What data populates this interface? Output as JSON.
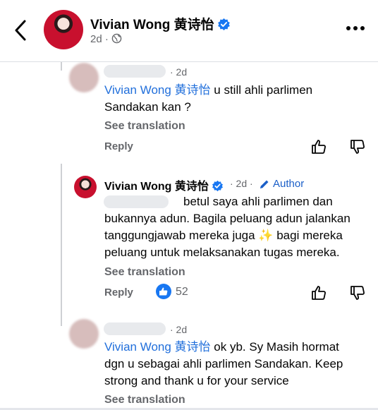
{
  "header": {
    "name": "Vivian Wong 黄诗怡",
    "time": "2d",
    "separator": "·"
  },
  "comments": [
    {
      "time": "· 2d",
      "mention": "Vivian Wong 黄诗怡",
      "text_line1": " u still ahli parlimen",
      "text_line2": "Sandakan kan ?",
      "see_translation": "See translation",
      "reply": "Reply"
    },
    {
      "author_name": "Vivian Wong 黄诗怡",
      "time": "· 2d ·",
      "author_badge": "Author",
      "text_line1": "betul saya ahli parlimen dan",
      "text_line2": "bukannya adun. Bagila peluang adun jalankan",
      "text_line3a": "tanggungjawab mereka juga ",
      "text_line3b": "✨",
      "text_line3c": " bagi mereka",
      "text_line4": "peluang untuk melaksanakan tugas mereka.",
      "see_translation": "See translation",
      "reply": "Reply",
      "like_count": "52"
    },
    {
      "time": "· 2d",
      "mention": "Vivian Wong 黄诗怡",
      "text_line1": " ok yb. Sy Masih hormat",
      "text_line2": "dgn u sebagai ahli parlimen Sandakan. Keep",
      "text_line3": "strong and thank u for your service",
      "see_translation": "See translation"
    }
  ],
  "colors": {
    "link": "#216fdb",
    "secondary": "#65676b",
    "verified": "#1877f2",
    "sparkle": "#f7c948"
  },
  "icons": {
    "back": "chevron-left-icon",
    "verified": "verified-badge-icon",
    "globe": "globe-icon",
    "more": "more-horizontal-icon",
    "like": "thumbs-up-icon",
    "dislike": "thumbs-down-icon",
    "pencil": "pencil-icon"
  }
}
